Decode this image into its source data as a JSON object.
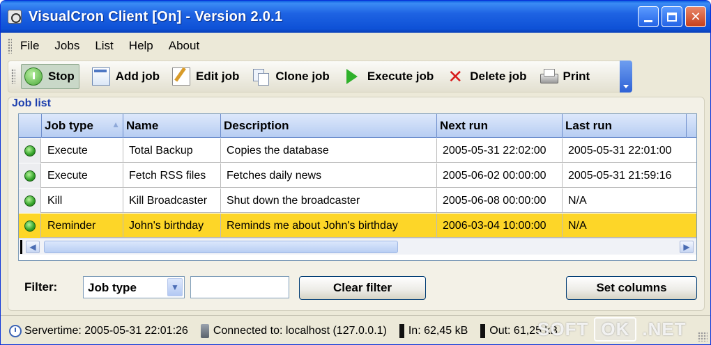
{
  "window": {
    "title": "VisualCron Client [On] - Version 2.0.1"
  },
  "menu": [
    "File",
    "Jobs",
    "List",
    "Help",
    "About"
  ],
  "toolbar": {
    "stop": "Stop",
    "add_job": "Add job",
    "edit_job": "Edit job",
    "clone_job": "Clone job",
    "execute_job": "Execute job",
    "delete_job": "Delete job",
    "print": "Print"
  },
  "job_list": {
    "title": "Job list",
    "columns": [
      "Job type",
      "Name",
      "Description",
      "Next run",
      "Last run"
    ],
    "rows": [
      {
        "status": "green",
        "job_type": "Execute",
        "name": "Total Backup",
        "description": "Copies the database",
        "next_run": "2005-05-31 22:02:00",
        "last_run": "2005-05-31 22:01:00",
        "selected": false
      },
      {
        "status": "green",
        "job_type": "Execute",
        "name": "Fetch RSS files",
        "description": "Fetches daily news",
        "next_run": "2005-06-02 00:00:00",
        "last_run": "2005-05-31 21:59:16",
        "selected": false
      },
      {
        "status": "green",
        "job_type": "Kill",
        "name": "Kill Broadcaster",
        "description": "Shut down the broadcaster",
        "next_run": "2005-06-08 00:00:00",
        "last_run": "N/A",
        "selected": false
      },
      {
        "status": "green",
        "job_type": "Reminder",
        "name": "John's birthday",
        "description": "Reminds me about John's birthday",
        "next_run": "2006-03-04 10:00:00",
        "last_run": "N/A",
        "selected": true
      }
    ]
  },
  "filter": {
    "label": "Filter:",
    "field_value": "Job type",
    "text_value": "",
    "clear_button": "Clear filter",
    "set_columns_button": "Set columns"
  },
  "statusbar": {
    "servertime": "Servertime: 2005-05-31 22:01:26",
    "connected": "Connected to: localhost (127.0.0.1)",
    "in": "In: 62,45 kB",
    "out": "Out: 61,25 kB"
  },
  "watermark": {
    "left": "SOFT",
    "box": "OK",
    "right": ".NET"
  },
  "colors": {
    "titlebar": "#0e51d6",
    "selected_row": "#fdd628",
    "status_green": "#33a32a"
  }
}
